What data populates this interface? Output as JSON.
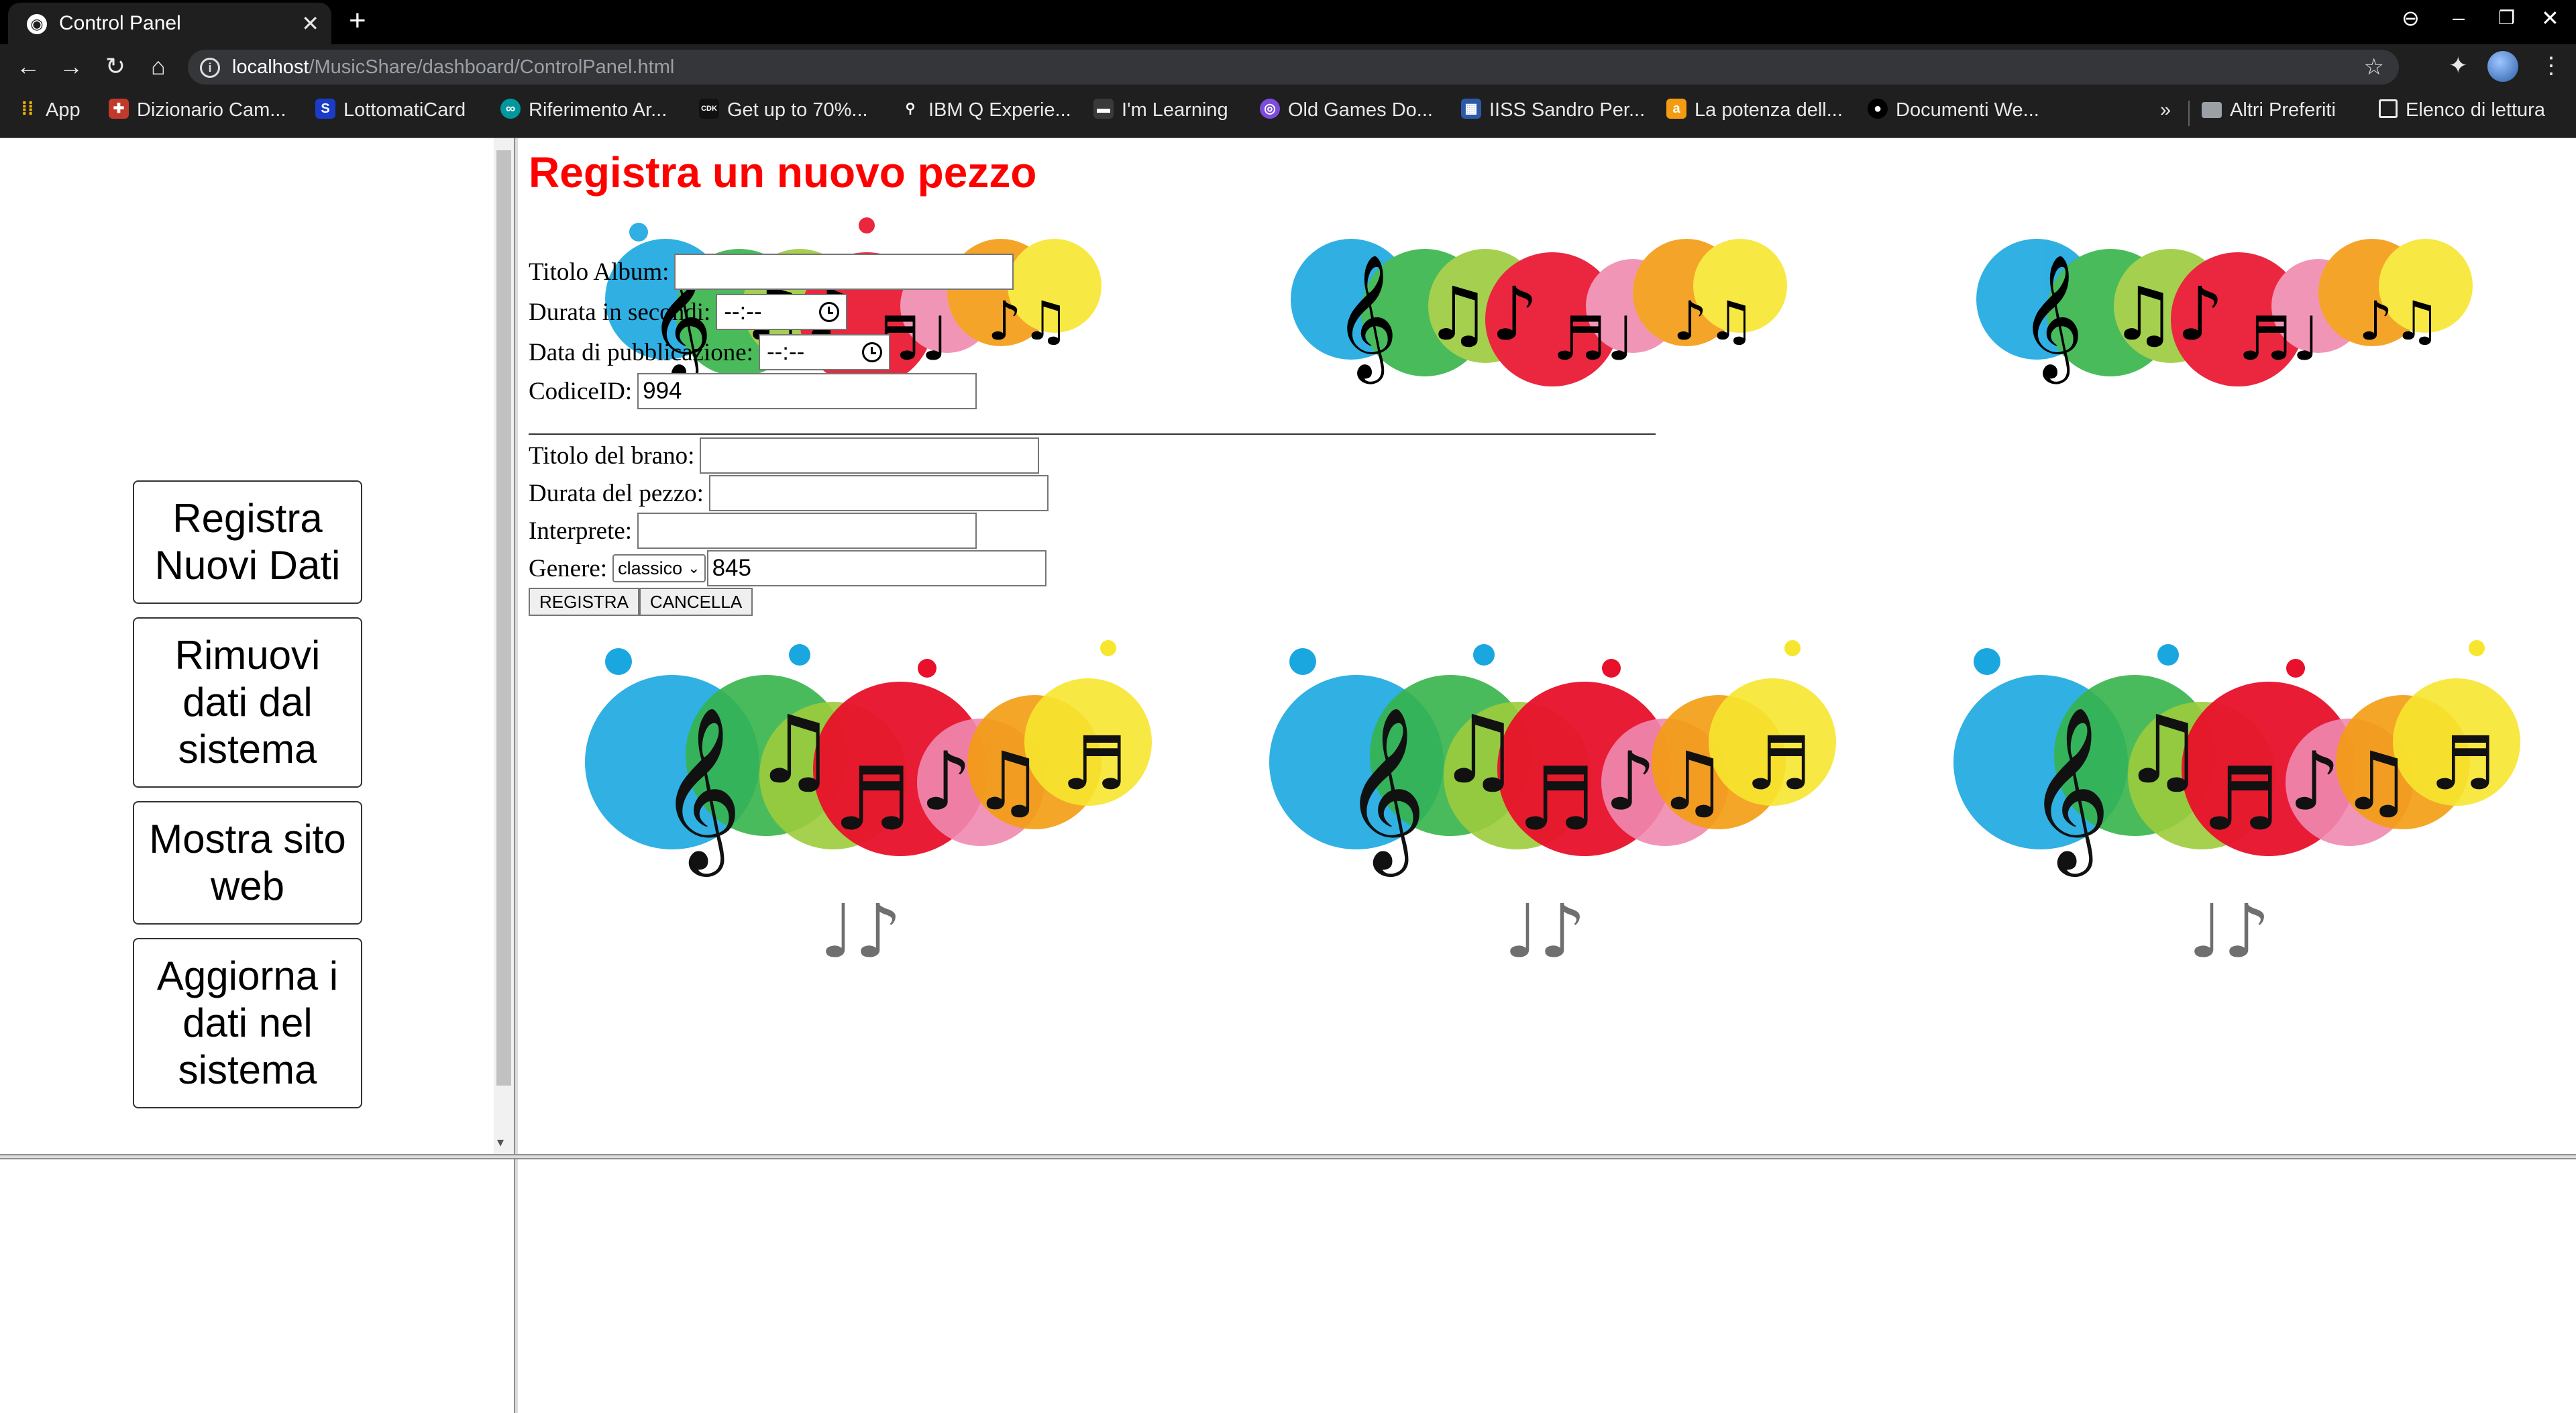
{
  "browser": {
    "tab_title": "Control Panel",
    "url_host": "localhost",
    "url_path": "/MusicShare/dashboard/ControlPanel.html",
    "bookmarks": [
      {
        "label": "App",
        "color": "#4285f4",
        "icon": "apps-grid-icon"
      },
      {
        "label": "Dizionario Cam...",
        "color": "#c0392b",
        "icon": "shield-icon"
      },
      {
        "label": "LottomatiCard",
        "color": "#1a3cc8",
        "icon": "s-logo-icon"
      },
      {
        "label": "Riferimento Ar...",
        "color": "#00979d",
        "icon": "arduino-icon"
      },
      {
        "label": "Get up to 70%...",
        "color": "#111111",
        "icon": "cdk-icon"
      },
      {
        "label": "IBM Q Experie...",
        "color": "#2f2f2f",
        "icon": "location-pin-icon"
      },
      {
        "label": "I'm Learning",
        "color": "#3a3a3a",
        "icon": "learning-icon"
      },
      {
        "label": "Old Games Do...",
        "color": "#7d4cdb",
        "icon": "games-icon"
      },
      {
        "label": "IISS Sandro Per...",
        "color": "#2d5aa8",
        "icon": "school-icon"
      },
      {
        "label": "La potenza dell...",
        "color": "#f39c12",
        "icon": "a-logo-icon"
      },
      {
        "label": "Documenti We...",
        "color": "#000000",
        "icon": "github-icon"
      }
    ],
    "overflow": "»",
    "other_bookmarks": "Altri Preferiti",
    "reading_list": "Elenco di lettura"
  },
  "sidebar": {
    "buttons": [
      {
        "label": "Registra Nuovi Dati"
      },
      {
        "label": "Rimuovi dati dal sistema"
      },
      {
        "label": "Mostra sito web"
      },
      {
        "label": "Aggiorna i dati nel sistema"
      }
    ]
  },
  "form": {
    "title": "Registra un nuovo pezzo",
    "album_title_label": "Titolo Album:",
    "album_title_value": "",
    "duration_seconds_label": "Durata in secondi:",
    "duration_seconds_value": "--:--",
    "publish_date_label": "Data di pubblicazione:",
    "publish_date_value": "--:--",
    "codice_id_label": "CodiceID:",
    "codice_id_value": "994",
    "track_title_label": "Titolo del brano:",
    "track_title_value": "",
    "track_duration_label": "Durata del pezzo:",
    "track_duration_value": "",
    "performer_label": "Interprete:",
    "performer_value": "",
    "genre_label": "Genere:",
    "genre_selected": "classico",
    "genre_code_value": "845",
    "register_button": "REGISTRA",
    "cancel_button": "CANCELLA"
  },
  "colors": {
    "title_red": "#ff0000",
    "chrome_dark": "#1f1f1f"
  }
}
